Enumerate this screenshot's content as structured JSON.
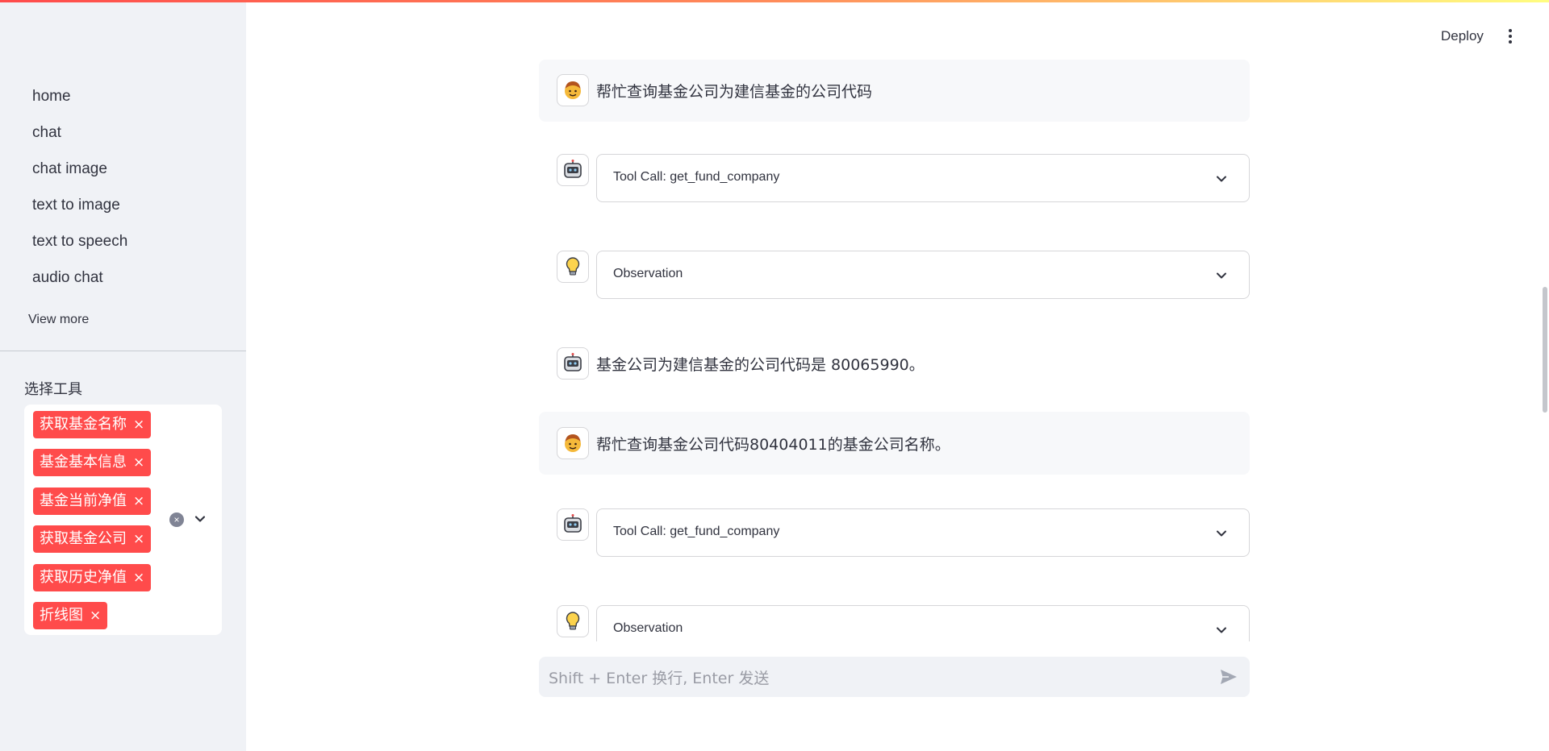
{
  "sidebar": {
    "nav": [
      "home",
      "chat",
      "chat image",
      "text to image",
      "text to speech",
      "audio chat"
    ],
    "view_more": "View more",
    "tools_label": "选择工具",
    "tools": [
      "获取基金名称",
      "基金基本信息",
      "基金当前净值",
      "获取基金公司",
      "获取历史净值",
      "折线图"
    ],
    "tag_remove_glyph": "×",
    "clear_glyph": "×"
  },
  "header": {
    "deploy": "Deploy"
  },
  "chat": {
    "user_msg_1": "帮忙查询基金公司为建信基金的公司代码",
    "tool_call_1": "Tool Call: get_fund_company",
    "observation_1": "Observation",
    "assistant_msg_1": "基金公司为建信基金的公司代码是 80065990。",
    "user_msg_2": "帮忙查询基金公司代码80404011的基金公司名称。",
    "tool_call_2": "Tool Call: get_fund_company",
    "observation_2": "Observation"
  },
  "input": {
    "placeholder": "Shift + Enter 换行, Enter 发送"
  },
  "icons": {
    "user_avatar": "person-face-icon",
    "assistant_avatar": "robot-face-icon",
    "observation_avatar": "light-bulb-icon",
    "expander": "chevron-down-icon",
    "send": "send-icon",
    "menu": "kebab-menu-icon"
  },
  "colors": {
    "accent": "#ff4b4b",
    "sidebar_bg": "#f0f2f6",
    "text": "#31333f",
    "user_msg_bg": "#f7f8fa"
  }
}
